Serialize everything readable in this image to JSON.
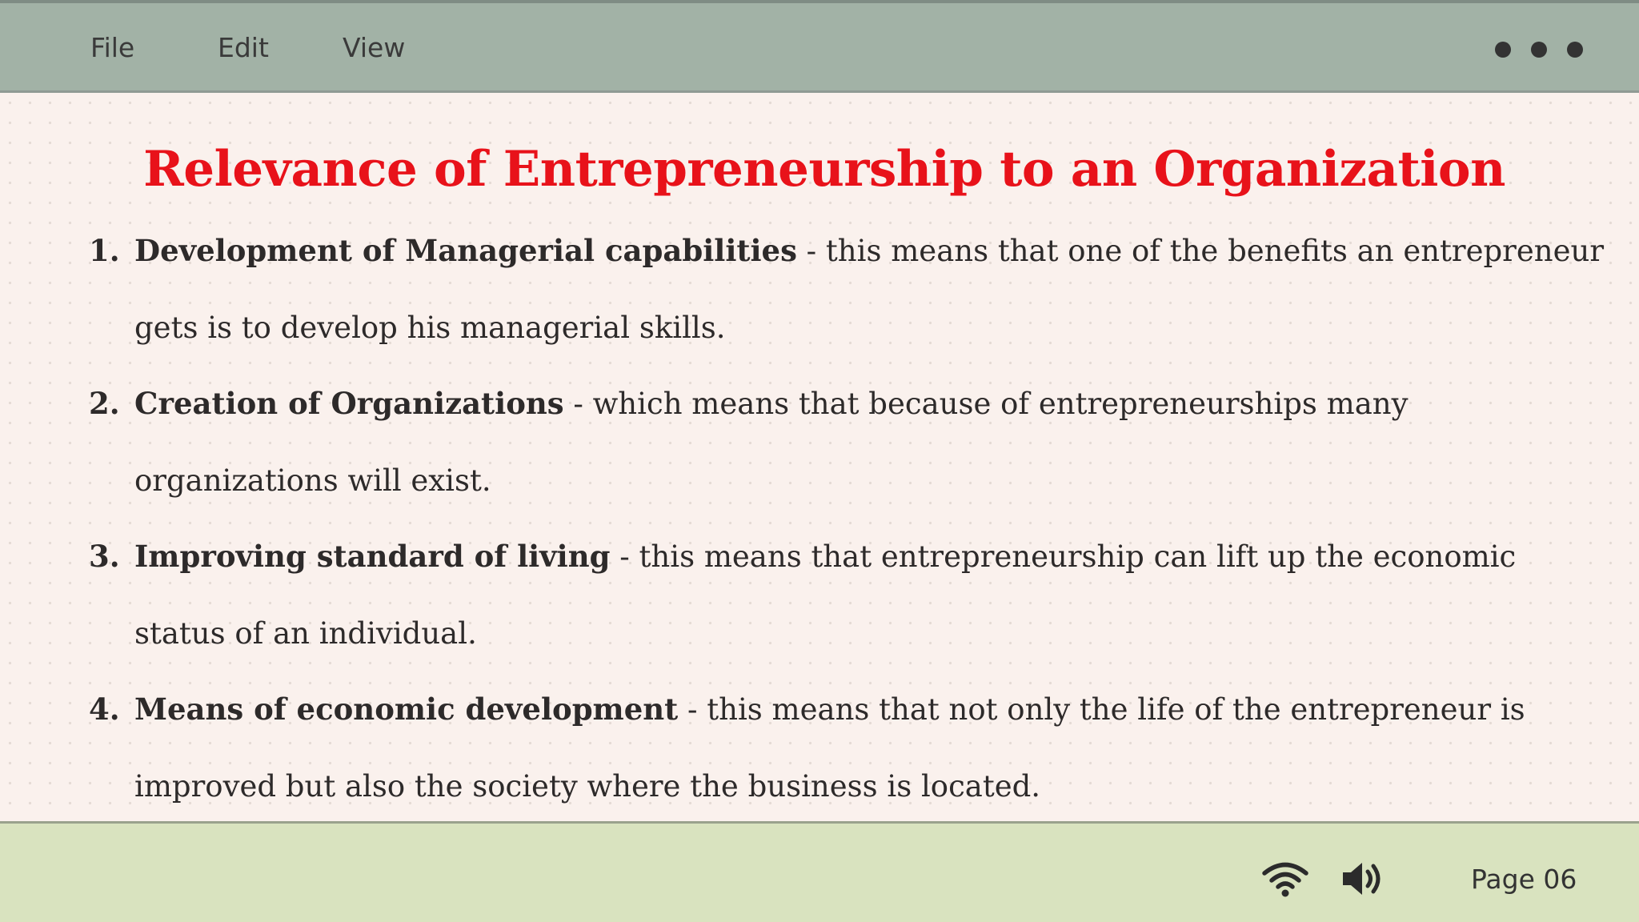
{
  "menubar": {
    "items": [
      "File",
      "Edit",
      "View"
    ],
    "more_icon": "more-horizontal-icon"
  },
  "slide": {
    "title": "Relevance of Entrepreneurship to an Organization",
    "items": [
      {
        "number": "1.",
        "term": "Development of Managerial capabilities",
        "description": " - this means that one of the benefits an entrepreneur gets is to develop his managerial skills."
      },
      {
        "number": "2.",
        "term": "Creation of Organizations",
        "description": " - which means that because of entrepreneurships many organizations will exist."
      },
      {
        "number": "3.",
        "term": "Improving standard of living",
        "description": " - this means that entrepreneurship can lift up the economic status of an individual."
      },
      {
        "number": "4.",
        "term": "Means of economic development",
        "description": " - this means that not only the life of the entrepreneur is improved but also the society where the business is located."
      }
    ]
  },
  "statusbar": {
    "wifi_icon": "wifi-icon",
    "volume_icon": "volume-icon",
    "page_label": "Page 06"
  },
  "colors": {
    "menubar_bg": "#a2b2a6",
    "content_bg": "#faf1ed",
    "title_red": "#e8121a",
    "statusbar_bg": "#d9e3bf"
  }
}
